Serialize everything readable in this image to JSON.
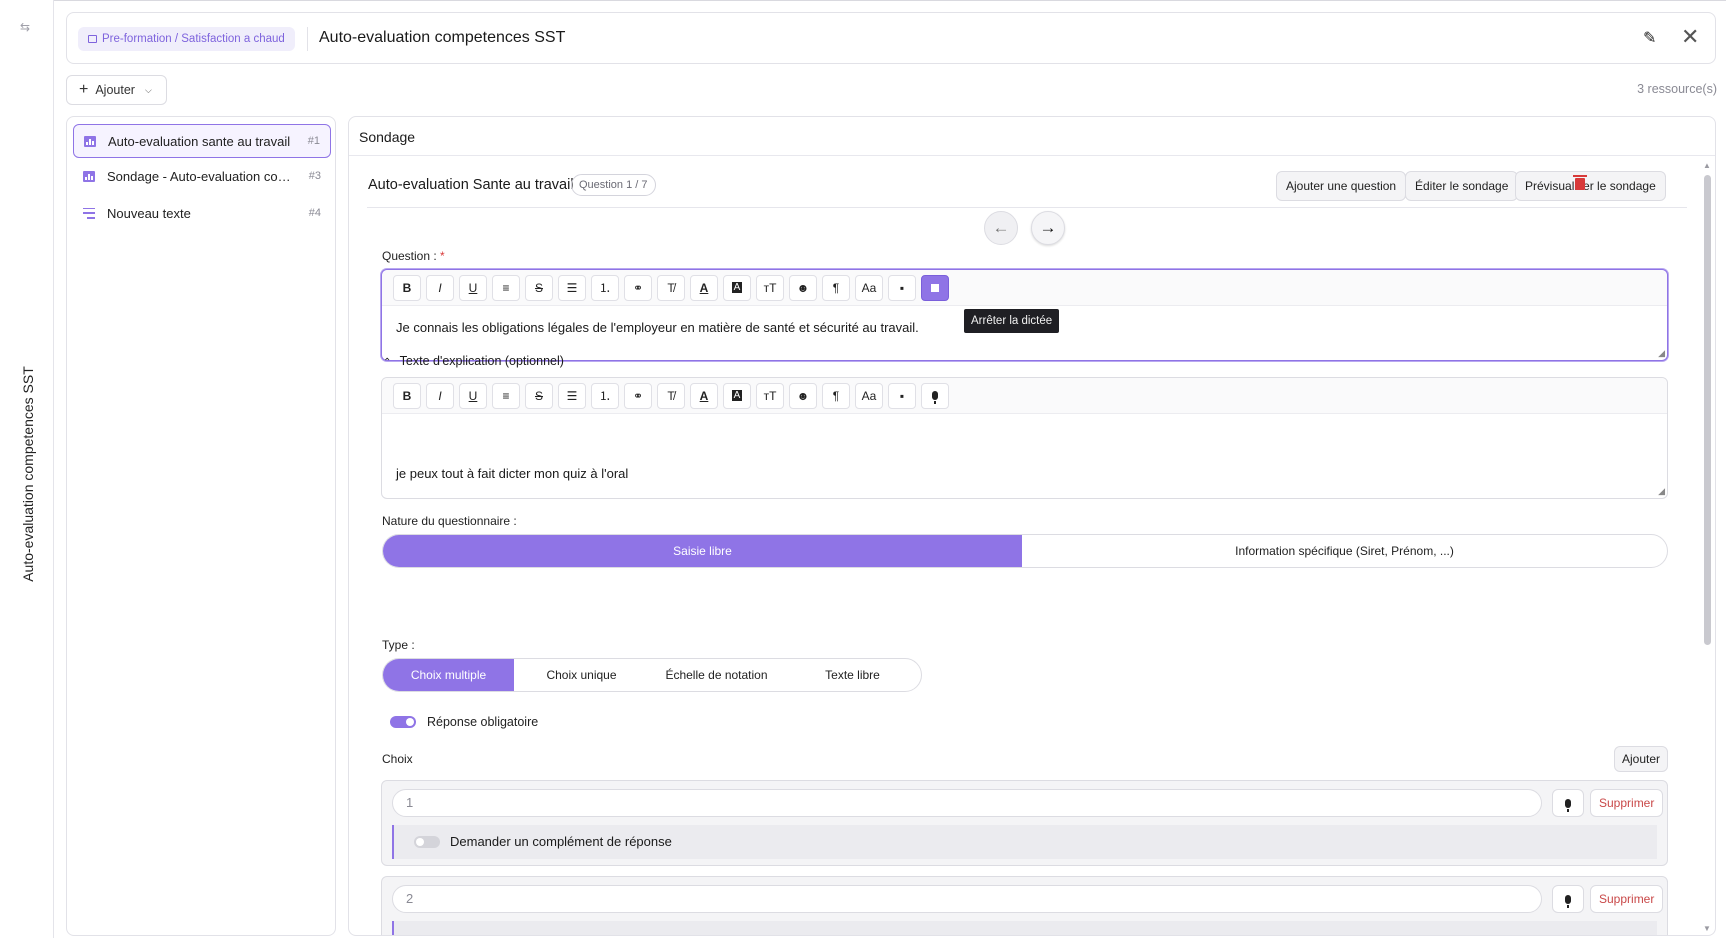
{
  "sidebar_collapsed": {
    "title": "Auto-evaluation competences SST",
    "collapse_icon": "⇆"
  },
  "header": {
    "breadcrumb": "Pre-formation / Satisfaction a chaud",
    "title": "Auto-evaluation competences SST",
    "edit_icon": "✎",
    "close_icon": "✕"
  },
  "toolbar": {
    "add_label": "Ajouter",
    "resources_count": "3 ressource(s)"
  },
  "resources": [
    {
      "label": "Auto-evaluation sante au travail",
      "num": "#1",
      "icon": "bar-chart-icon",
      "active": true
    },
    {
      "label": "Sondage - Auto-evaluation competences SST",
      "num": "#3",
      "icon": "bar-chart-icon",
      "active": false
    },
    {
      "label": "Nouveau texte",
      "num": "#4",
      "icon": "text-lines-icon",
      "active": false
    }
  ],
  "panel": {
    "title": "Sondage",
    "survey_name": "Auto-evaluation Sante au travail",
    "question_counter": "Question 1 / 7",
    "buttons": {
      "add_question": "Ajouter une question",
      "edit_survey": "Éditer le sondage",
      "preview_survey": "Prévisualiser le sondage"
    },
    "nav": {
      "prev": "←",
      "next": "→"
    }
  },
  "question_editor": {
    "label": "Question :",
    "required_mark": "*",
    "content": "Je connais les obligations légales de l'employeur en matière de santé et sécurité au travail.",
    "tooltip": "Arrêter la dictée",
    "tools": [
      "B",
      "I",
      "U",
      "≡",
      "S",
      "☰",
      "⒈",
      "⚭",
      "T̸",
      "A",
      "A",
      "ᴛT",
      "☻",
      "¶",
      "Aa",
      "▪"
    ]
  },
  "explanation": {
    "toggle_label": "Texte d'explication (optionnel)",
    "content": "je peux tout à fait dicter mon quiz à l'oral"
  },
  "nature": {
    "label": "Nature du questionnaire :",
    "options": [
      "Saisie libre",
      "Information spécifique (Siret, Prénom, ...)"
    ],
    "selected": "Saisie libre"
  },
  "type": {
    "label": "Type :",
    "options": [
      "Choix multiple",
      "Choix unique",
      "Échelle de notation",
      "Texte libre"
    ],
    "selected": "Choix multiple"
  },
  "mandatory": {
    "label": "Réponse obligatoire",
    "on": true
  },
  "choices": {
    "label": "Choix",
    "add_label": "Ajouter",
    "delete_label": "Supprimer",
    "complement_label": "Demander un complément de réponse",
    "items": [
      {
        "placeholder": "1"
      },
      {
        "placeholder": "2"
      }
    ]
  },
  "colors": {
    "accent": "#8f74e6",
    "danger": "#d83a3a"
  }
}
